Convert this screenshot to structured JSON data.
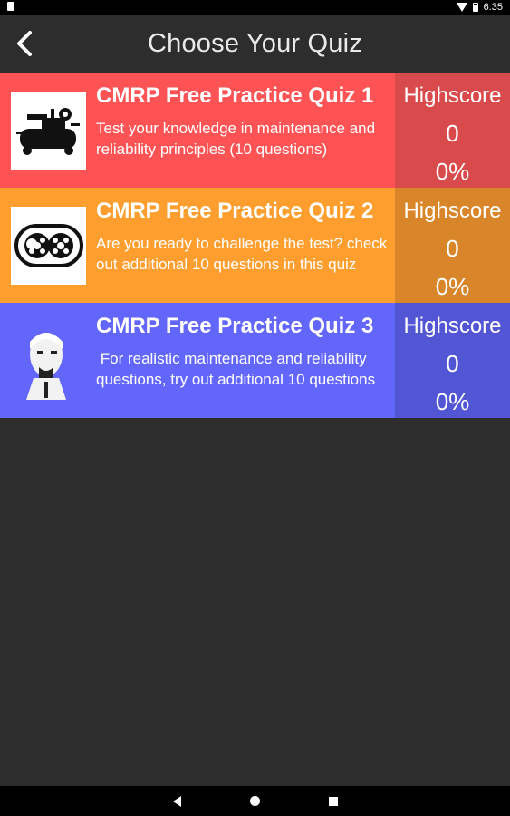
{
  "status_bar": {
    "time": "6:35",
    "icons": [
      "notification-doc-icon",
      "signal-icon",
      "battery-icon"
    ]
  },
  "app_bar": {
    "title": "Choose Your Quiz",
    "back_icon": "back-arrow-icon"
  },
  "quizzes": [
    {
      "title": "CMRP Free Practice Quiz 1",
      "description": "Test your knowledge in maintenance and reliability principles (10 questions)",
      "thumbnail": "air-compressor-icon",
      "highscore_label": "Highscore",
      "highscore_value": "0",
      "highscore_percent": "0%",
      "color": "#fe5355",
      "score_color": "#d84a4c"
    },
    {
      "title": "CMRP Free Practice Quiz 2",
      "description": "Are you ready to challenge the test? check out additional 10 questions in this quiz",
      "thumbnail": "gear-pump-icon",
      "highscore_label": "Highscore",
      "highscore_value": "0",
      "highscore_percent": "0%",
      "color": "#fe9e2f",
      "score_color": "#d9862a"
    },
    {
      "title": "CMRP Free Practice Quiz 3",
      "description": " For realistic maintenance and reliability questions, try out additional 10 questions",
      "thumbnail": "portrait-icon",
      "highscore_label": "Highscore",
      "highscore_value": "0",
      "highscore_percent": "0%",
      "color": "#6366fb",
      "score_color": "#5356d4"
    }
  ],
  "nav_bar": {
    "icons": [
      "nav-back-icon",
      "nav-home-icon",
      "nav-recents-icon"
    ]
  }
}
